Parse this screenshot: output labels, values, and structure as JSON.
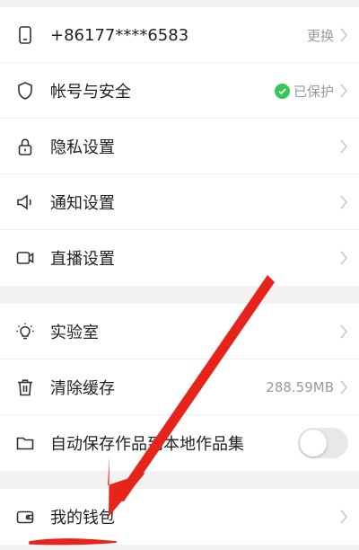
{
  "groups": [
    {
      "rows": [
        {
          "icon": "phone-icon",
          "label": "+86177****6583",
          "value": "更换",
          "chevron": true
        },
        {
          "icon": "shield-icon",
          "label": "帐号与安全",
          "value": "已保护",
          "badge": "check-circle-icon",
          "chevron": true
        },
        {
          "icon": "lock-icon",
          "label": "隐私设置",
          "chevron": true
        },
        {
          "icon": "speaker-icon",
          "label": "通知设置",
          "chevron": true
        },
        {
          "icon": "video-camera-icon",
          "label": "直播设置",
          "chevron": true
        }
      ]
    },
    {
      "rows": [
        {
          "icon": "lightbulb-icon",
          "label": "实验室",
          "chevron": true
        },
        {
          "icon": "trash-icon",
          "label": "清除缓存",
          "value": "288.59MB",
          "chevron": true
        },
        {
          "icon": "folder-icon",
          "label": "自动保存作品到本地作品集",
          "toggle": false
        }
      ]
    },
    {
      "rows": [
        {
          "icon": "wallet-icon",
          "label": "我的钱包",
          "chevron": true
        }
      ]
    }
  ],
  "colors": {
    "annotation_red": "#e8231c",
    "badge_green": "#34c759",
    "divider_gray": "#f2f2f2"
  }
}
